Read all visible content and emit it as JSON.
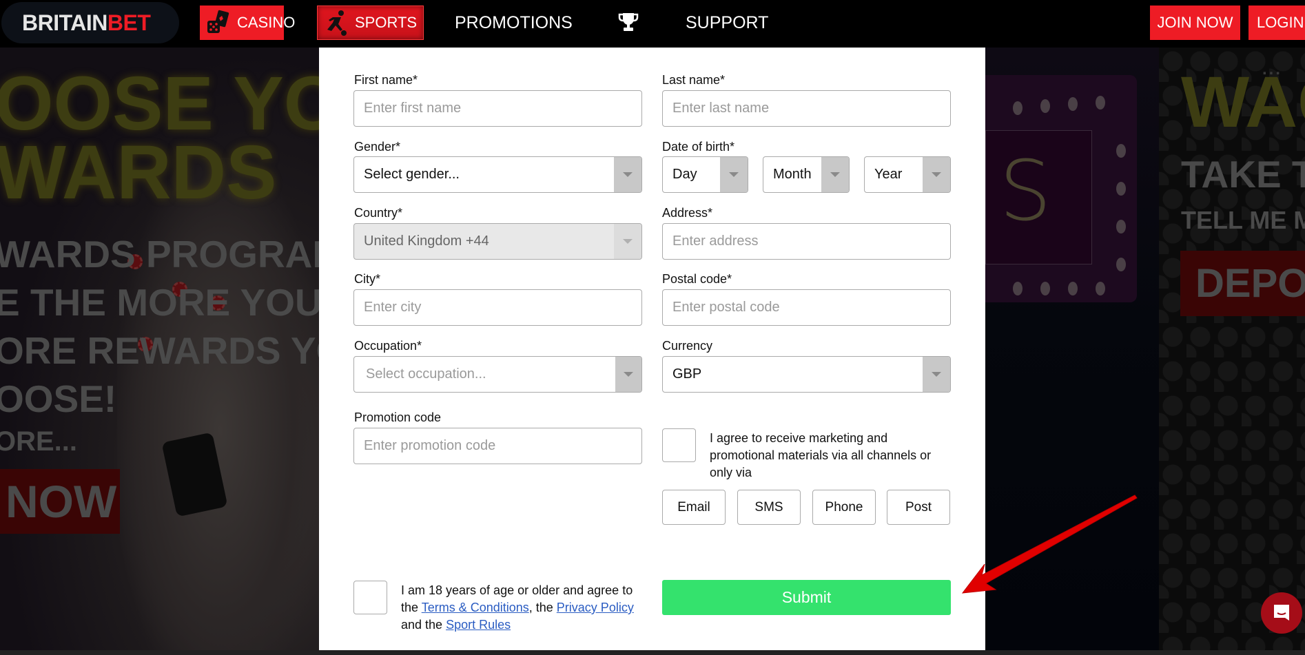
{
  "header": {
    "logo": {
      "part1": "BRITAIN",
      "part2": "BET"
    },
    "nav": [
      {
        "label": "CASINO",
        "icon": "dice-cards-icon",
        "active": false
      },
      {
        "label": "SPORTS",
        "icon": "soccer-player-icon",
        "active": true
      },
      {
        "label": "PROMOTIONS"
      },
      {
        "label": "",
        "icon": "trophy-icon"
      },
      {
        "label": "SUPPORT"
      }
    ],
    "join_label": "JOIN NOW",
    "login_label": "LOGIN"
  },
  "background": {
    "left_banner": {
      "headline1": "OOSE YOUR",
      "headline2": "WARDS",
      "line1": "WARDS PROGRAM",
      "line2": "E THE MORE YOU P",
      "line3": "ORE REWARDS YOU",
      "line4": "OOSE!",
      "line5": "ORE...",
      "button": "NOW"
    },
    "right_banner": {
      "dots": "...",
      "headline": "WAG",
      "line1": "TAKE T",
      "line2": "TELL ME M",
      "button": "DEPO"
    },
    "marquee_letter": "S"
  },
  "form": {
    "first_name": {
      "label": "First name*",
      "placeholder": "Enter first name"
    },
    "last_name": {
      "label": "Last name*",
      "placeholder": "Enter last name"
    },
    "gender": {
      "label": "Gender*",
      "value": "Select gender..."
    },
    "dob": {
      "label": "Date of birth*",
      "day": "Day",
      "month": "Month",
      "year": "Year"
    },
    "country": {
      "label": "Country*",
      "value": "United Kingdom +44",
      "disabled": true
    },
    "address": {
      "label": "Address*",
      "placeholder": "Enter address"
    },
    "city": {
      "label": "City*",
      "placeholder": "Enter city"
    },
    "postal_code": {
      "label": "Postal code*",
      "placeholder": "Enter postal code"
    },
    "occupation": {
      "label": "Occupation*",
      "value": "Select occupation..."
    },
    "currency": {
      "label": "Currency",
      "value": "GBP"
    },
    "promotion_code": {
      "label": "Promotion code",
      "placeholder": "Enter promotion code"
    },
    "marketing": {
      "text": "I agree to receive marketing and promotional materials via all channels or only via",
      "checked": false,
      "channels": [
        "Email",
        "SMS",
        "Phone",
        "Post"
      ]
    },
    "terms": {
      "checked": false,
      "text1": "I am 18 years of age or older and agree to the ",
      "link1": "Terms & Conditions",
      "text2": ", the ",
      "link2": "Privacy Policy",
      "text3": " and the ",
      "link3": "Sport Rules"
    },
    "submit_label": "Submit"
  },
  "colors": {
    "brand_red": "#ee1c25",
    "submit_green": "#34e26d",
    "link_blue": "#2a5cc2",
    "chat_red": "#a50d18"
  }
}
